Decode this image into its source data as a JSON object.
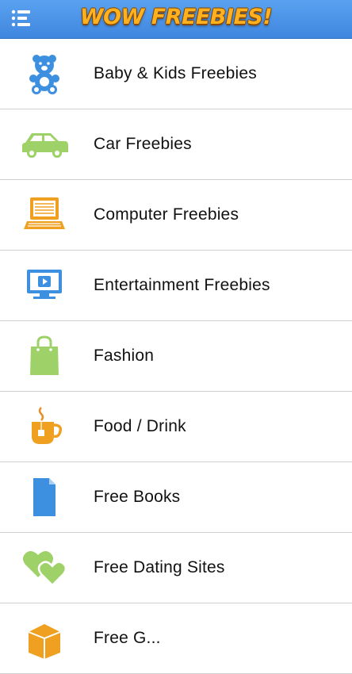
{
  "header": {
    "logo_text": "WOW FREEBIES!",
    "menu_icon": "list-menu-icon",
    "background_color": "#4a92e8",
    "logo_color": "#ffb11f"
  },
  "categories": [
    {
      "label": "Baby & Kids Freebies",
      "icon": "teddy-bear-icon",
      "color": "#3d8fe0"
    },
    {
      "label": "Car Freebies",
      "icon": "car-icon",
      "color": "#9ed168"
    },
    {
      "label": "Computer Freebies",
      "icon": "laptop-icon",
      "color": "#f0a020"
    },
    {
      "label": "Entertainment Freebies",
      "icon": "tv-play-icon",
      "color": "#3d8fe0"
    },
    {
      "label": "Fashion",
      "icon": "shopping-bag-icon",
      "color": "#9ed168"
    },
    {
      "label": "Food / Drink",
      "icon": "hot-drink-icon",
      "color": "#f0a020"
    },
    {
      "label": "Free Books",
      "icon": "document-icon",
      "color": "#3d8fe0"
    },
    {
      "label": "Free Dating Sites",
      "icon": "two-hearts-icon",
      "color": "#9ed168"
    },
    {
      "label": "Free G...",
      "icon": "game-box-icon",
      "color": "#f0a020"
    }
  ]
}
